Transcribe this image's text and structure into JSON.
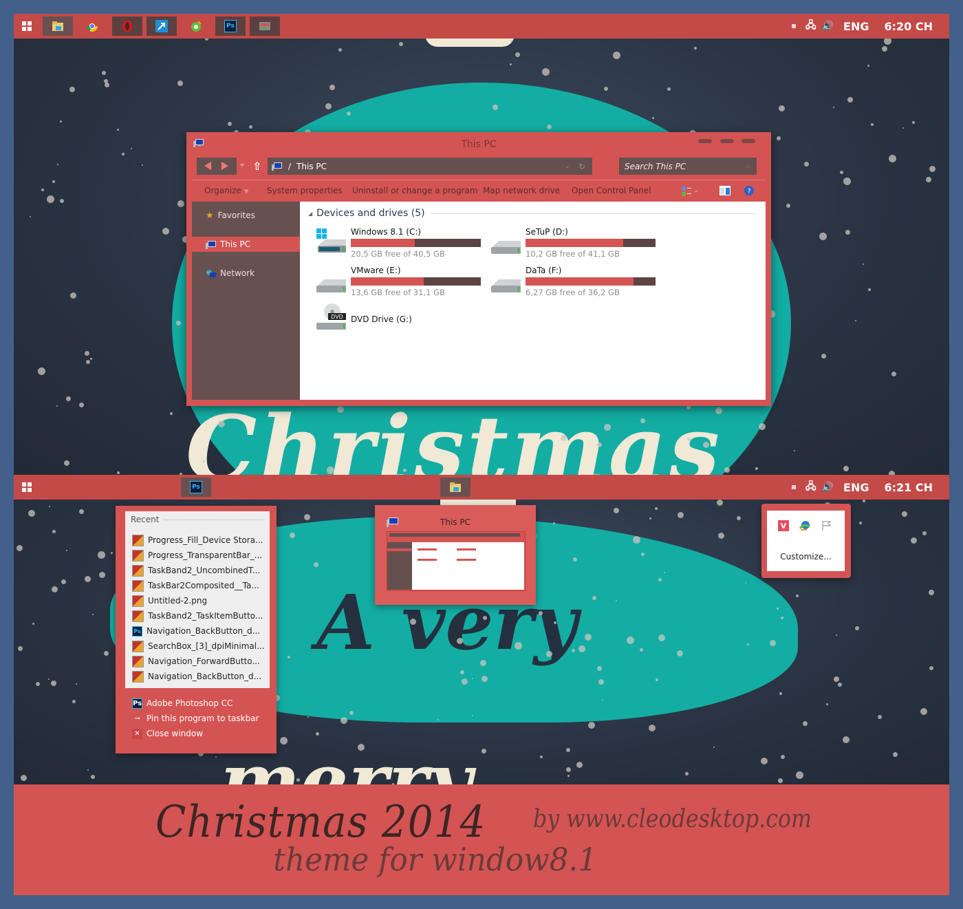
{
  "colors": {
    "accent": "#d45453",
    "taskbar": "#c44a48",
    "dark_brown": "#66504f",
    "frame": "#42608a",
    "wallpaper_teal": "#13ada3",
    "wallpaper_dark": "#2b3444"
  },
  "taskbar_top": {
    "start_icon": "windows-logo-icon",
    "pinned": [
      {
        "name": "file-explorer",
        "icon": "folder-icon",
        "state": "highlight"
      },
      {
        "name": "chrome",
        "icon": "chrome-icon",
        "state": "normal"
      },
      {
        "name": "opera",
        "icon": "opera-icon",
        "state": "active"
      },
      {
        "name": "shortcut",
        "icon": "arrow-shortcut-icon",
        "state": "active"
      },
      {
        "name": "app-green",
        "icon": "green-app-icon",
        "state": "normal"
      },
      {
        "name": "photoshop",
        "icon": "photoshop-icon",
        "state": "active",
        "label": "Ps"
      },
      {
        "name": "app-tools",
        "icon": "tools-app-icon",
        "state": "active"
      }
    ],
    "tray": {
      "language": "ENG",
      "clock": "6:20 CH"
    }
  },
  "explorer": {
    "title": "This PC",
    "address": {
      "separator": "/",
      "location": "This PC"
    },
    "search_placeholder": "Search This PC",
    "commands": [
      "Organize",
      "System properties",
      "Uninstall or change a program",
      "Map network drive",
      "Open Control Panel"
    ],
    "nav": [
      {
        "label": "Favorites",
        "icon": "star-icon",
        "selected": false
      },
      {
        "label": "This PC",
        "icon": "computer-icon",
        "selected": true
      },
      {
        "label": "Network",
        "icon": "network-icon",
        "selected": false
      }
    ],
    "group_header": "Devices and drives (5)",
    "drives": [
      {
        "name": "Windows 8.1 (C:)",
        "free_text": "20,5 GB free of 40,5 GB",
        "used_fraction": 0.49,
        "icon": "windows-drive-icon"
      },
      {
        "name": "SeTuP (D:)",
        "free_text": "10,2 GB free of 41,1 GB",
        "used_fraction": 0.75,
        "icon": "hard-drive-icon"
      },
      {
        "name": "VMware (E:)",
        "free_text": "13,6 GB free of 31,1 GB",
        "used_fraction": 0.56,
        "icon": "hard-drive-icon"
      },
      {
        "name": "DaTa (F:)",
        "free_text": "6,27 GB free of 36,2 GB",
        "used_fraction": 0.83,
        "icon": "hard-drive-icon"
      },
      {
        "name": "DVD Drive (G:)",
        "free_text": "",
        "used_fraction": null,
        "icon": "dvd-drive-icon",
        "badge": "DVD"
      }
    ]
  },
  "taskbar_bottom": {
    "apps": [
      {
        "name": "photoshop",
        "label": "Ps"
      },
      {
        "name": "file-explorer"
      }
    ],
    "tray": {
      "language": "ENG",
      "clock": "6:21 CH"
    }
  },
  "jumplist": {
    "header": "Recent",
    "recent": [
      {
        "label": "Progress_Fill_Device Stora...",
        "type": "image"
      },
      {
        "label": "Progress_TransparentBar_...",
        "type": "image"
      },
      {
        "label": "TaskBand2_UncombinedT...",
        "type": "image"
      },
      {
        "label": "TaskBar2Composited__Ta...",
        "type": "image"
      },
      {
        "label": "Untitled-2.png",
        "type": "image"
      },
      {
        "label": "TaskBand2_TaskItemButto...",
        "type": "image"
      },
      {
        "label": "Navigation_BackButton_d...",
        "type": "psd"
      },
      {
        "label": "SearchBox_[3]_dpiMinimal...",
        "type": "image"
      },
      {
        "label": "Navigation_ForwardButto...",
        "type": "image"
      },
      {
        "label": "Navigation_BackButton_d...",
        "type": "image"
      }
    ],
    "tasks": [
      {
        "label": "Adobe Photoshop CC",
        "icon": "photoshop-icon"
      },
      {
        "label": "Pin this program to taskbar",
        "icon": "pin-icon"
      },
      {
        "label": "Close window",
        "icon": "close-icon"
      }
    ]
  },
  "thumbnail": {
    "title": "This PC"
  },
  "tray_flyout": {
    "icons": [
      "vivaldi-icon",
      "download-manager-icon",
      "action-center-flag-icon"
    ],
    "customize_label": "Customize..."
  },
  "wallpaper": {
    "words": [
      "Christmas",
      "A very",
      "merry"
    ]
  },
  "banner": {
    "title": "Christmas 2014",
    "subtitle": "theme for window8.1",
    "credit": "by www.cleodesktop.com"
  }
}
